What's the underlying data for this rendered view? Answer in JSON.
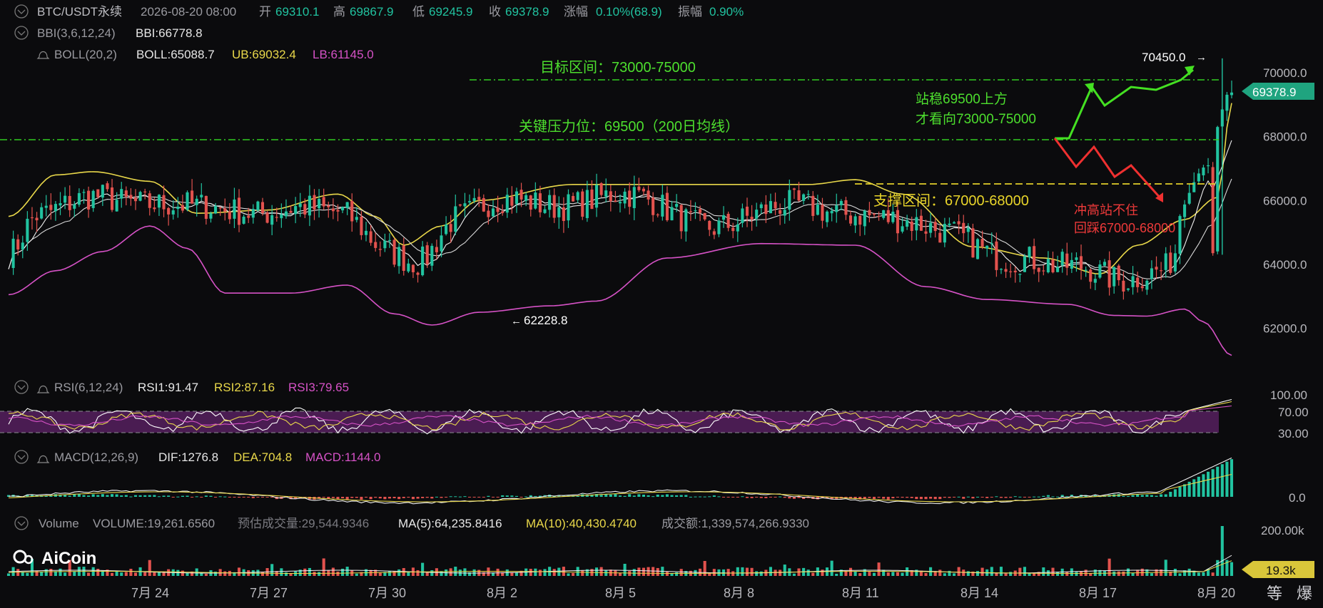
{
  "header": {
    "symbol": "BTC/USDT永续",
    "datetime": "2026-08-20 08:00",
    "open_label": "开",
    "open": "69310.1",
    "high_label": "高",
    "high": "69867.9",
    "low_label": "低",
    "low": "69245.9",
    "close_label": "收",
    "close": "69378.9",
    "change_label": "涨幅",
    "change": "0.10%(68.9)",
    "amp_label": "振幅",
    "amp": "0.90%"
  },
  "indicators": {
    "bbi": {
      "name": "BBI(3,6,12,24)",
      "text": "BBI:66778.8"
    },
    "boll": {
      "name": "BOLL(20,2)",
      "mb": "BOLL:65088.7",
      "ub": "UB:69032.4",
      "lb": "LB:61145.0"
    },
    "rsi": {
      "name": "RSI(6,12,24)",
      "r1": "RSI1:91.47",
      "r2": "RSI2:87.16",
      "r3": "RSI3:79.65"
    },
    "macd": {
      "name": "MACD(12,26,9)",
      "dif": "DIF:1276.8",
      "dea": "DEA:704.8",
      "macd": "MACD:1144.0"
    },
    "volume": {
      "name": "Volume",
      "vol": "VOLUME:19,261.6560",
      "est": "预估成交量:29,544.9346",
      "ma5": "MA(5):64,235.8416",
      "ma10": "MA(10):40,430.4740",
      "amount": "成交额:1,339,574,266.9330"
    }
  },
  "annotations": {
    "target": "目标区间：73000-75000",
    "resistance": "关键压力位：69500（200日均线）",
    "support": "支撑区间：67000-68000",
    "bull_line1": "站稳69500上方",
    "bull_line2": "才看向73000-75000",
    "bear_line1": "冲高站不住",
    "bear_line2": "回踩67000-68000",
    "high_marker": "70450.0",
    "low_marker": "62228.8"
  },
  "price_tag": "69378.9",
  "volume_tag": "19.3k",
  "logo": "AiCoin",
  "footer_buttons": [
    "等",
    "爆"
  ],
  "colors": {
    "up": "#21c3a0",
    "down": "#e2524e",
    "boll_band": "#e9d84a",
    "lower_band": "#d652c6",
    "guide_green": "#33cc22",
    "guide_yellow": "#e2cf2a",
    "bull_arrow": "#44e022",
    "bear_arrow": "#ef3030",
    "tag_bg": "#1fa47f"
  },
  "chart_data": [
    {
      "type": "candlestick",
      "title": "BTC/USDT永续",
      "x_ticks": [
        "7月 24",
        "7月 27",
        "7月 30",
        "8月 2",
        "8月 5",
        "8月 8",
        "8月 11",
        "8月 14",
        "8月 17",
        "8月 20"
      ],
      "y_ticks": [
        62000,
        64000,
        66000,
        68000,
        70000
      ],
      "ylim": [
        61200,
        70700
      ],
      "series": [
        {
          "name": "BOLL:65088.7",
          "anchors": [
            [
              0,
              64300
            ],
            [
              6,
              65300
            ],
            [
              20,
              66300
            ],
            [
              40,
              65600
            ],
            [
              60,
              65900
            ],
            [
              70,
              65400
            ],
            [
              80,
              64550
            ],
            [
              87,
              64300
            ],
            [
              95,
              65400
            ],
            [
              110,
              66000
            ],
            [
              125,
              66100
            ],
            [
              150,
              65400
            ],
            [
              172,
              65700
            ],
            [
              180,
              65800
            ],
            [
              200,
              64800
            ],
            [
              215,
              64350
            ],
            [
              225,
              63750
            ],
            [
              235,
              63500
            ],
            [
              245,
              64050
            ],
            [
              255,
              66500
            ],
            [
              260,
              68300
            ]
          ]
        },
        {
          "name": "UB:69032.4",
          "anchors": [
            [
              0,
              65500
            ],
            [
              10,
              66800
            ],
            [
              18,
              66900
            ],
            [
              30,
              66600
            ],
            [
              40,
              65600
            ],
            [
              55,
              65700
            ],
            [
              70,
              66200
            ],
            [
              78,
              65500
            ],
            [
              84,
              64600
            ],
            [
              92,
              65200
            ],
            [
              100,
              66000
            ],
            [
              120,
              66500
            ],
            [
              150,
              66500
            ],
            [
              170,
              66500
            ],
            [
              180,
              66650
            ],
            [
              190,
              66200
            ],
            [
              205,
              64550
            ],
            [
              220,
              64200
            ],
            [
              232,
              63700
            ],
            [
              240,
              64600
            ],
            [
              250,
              65400
            ],
            [
              257,
              66100
            ],
            [
              260,
              69050
            ]
          ]
        },
        {
          "name": "LB:61145.0",
          "anchors": [
            [
              0,
              63050
            ],
            [
              10,
              63800
            ],
            [
              20,
              64400
            ],
            [
              30,
              65200
            ],
            [
              38,
              64500
            ],
            [
              46,
              63100
            ],
            [
              60,
              63100
            ],
            [
              72,
              63350
            ],
            [
              82,
              62450
            ],
            [
              90,
              62100
            ],
            [
              100,
              62500
            ],
            [
              115,
              62700
            ],
            [
              125,
              62850
            ],
            [
              140,
              64200
            ],
            [
              160,
              64650
            ],
            [
              180,
              64600
            ],
            [
              195,
              63300
            ],
            [
              208,
              62900
            ],
            [
              225,
              62750
            ],
            [
              235,
              62400
            ],
            [
              242,
              62380
            ],
            [
              250,
              62600
            ],
            [
              254,
              62200
            ],
            [
              260,
              61150
            ]
          ]
        }
      ],
      "notable": {
        "high": 70450.0,
        "low": 62228.8,
        "last": 69378.9
      }
    },
    {
      "type": "line",
      "title": "RSI(6,12,24)",
      "y_ticks": [
        100,
        70,
        30
      ],
      "ylim": [
        20,
        110
      ],
      "series": [
        {
          "name": "RSI1:91.47",
          "last": 91.47
        },
        {
          "name": "RSI2:87.16",
          "last": 87.16
        },
        {
          "name": "RSI3:79.65",
          "last": 79.65
        }
      ]
    },
    {
      "type": "bar",
      "title": "MACD(12,26,9)",
      "y_ticks": [
        0
      ],
      "series": [
        {
          "name": "DIF:1276.8",
          "last": 1276.8
        },
        {
          "name": "DEA:704.8",
          "last": 704.8
        },
        {
          "name": "MACD:1144.0",
          "last": 1144.0
        }
      ]
    },
    {
      "type": "bar",
      "title": "Volume",
      "y_ticks": [
        "200.00k"
      ],
      "series": [
        {
          "name": "VOLUME:19,261.6560",
          "last": 19261.656
        },
        {
          "name": "MA(5):64,235.8416",
          "last": 64235.8416
        },
        {
          "name": "MA(10):40,430.4740",
          "last": 40430.474
        }
      ]
    }
  ]
}
